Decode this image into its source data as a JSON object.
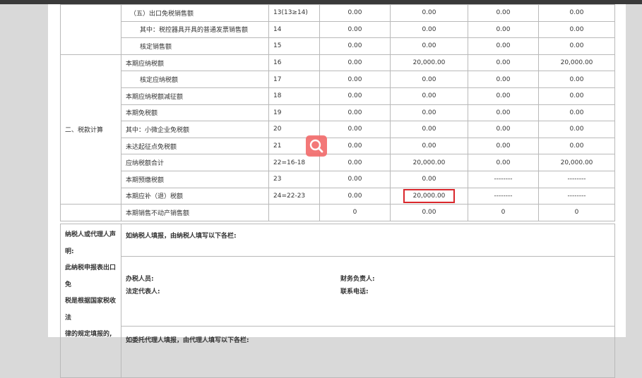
{
  "rows": [
    {
      "label": "（五）出口免税销售额",
      "no": "13(13≥14)",
      "v1": "0.00",
      "v2": "0.00",
      "v3": "0.00",
      "v4": "0.00",
      "indent": 1
    },
    {
      "label": "其中：税控器具开具的普通发票销售额",
      "no": "14",
      "v1": "0.00",
      "v2": "0.00",
      "v3": "0.00",
      "v4": "0.00",
      "indent": 2
    },
    {
      "label": "核定销售额",
      "no": "15",
      "v1": "0.00",
      "v2": "0.00",
      "v3": "0.00",
      "v4": "0.00",
      "indent": 2
    },
    {
      "label": "本期应纳税额",
      "no": "16",
      "v1": "0.00",
      "v2": "20,000.00",
      "v3": "0.00",
      "v4": "20,000.00",
      "indent": 0
    },
    {
      "label": "核定应纳税额",
      "no": "17",
      "v1": "0.00",
      "v2": "0.00",
      "v3": "0.00",
      "v4": "0.00",
      "indent": 2
    },
    {
      "label": "本期应纳税额减征额",
      "no": "18",
      "v1": "0.00",
      "v2": "0.00",
      "v3": "0.00",
      "v4": "0.00",
      "indent": 0
    },
    {
      "label": "本期免税额",
      "no": "19",
      "v1": "0.00",
      "v2": "0.00",
      "v3": "0.00",
      "v4": "0.00",
      "indent": 0
    },
    {
      "label": "其中：小微企业免税额",
      "no": "20",
      "v1": "0.00",
      "v2": "0.00",
      "v3": "0.00",
      "v4": "0.00",
      "indent": 0
    },
    {
      "label": "未达起征点免税额",
      "no": "21",
      "v1": "0.00",
      "v2": "0.00",
      "v3": "0.00",
      "v4": "0.00",
      "indent": 0
    },
    {
      "label": "应纳税额合计",
      "no": "22=16-18",
      "v1": "0.00",
      "v2": "20,000.00",
      "v3": "0.00",
      "v4": "20,000.00",
      "indent": 0
    },
    {
      "label": "本期预缴税额",
      "no": "23",
      "v1": "0.00",
      "v2": "0.00",
      "v3": "--------",
      "v4": "--------",
      "indent": 0
    },
    {
      "label": "本期应补（退）税额",
      "no": "24=22-23",
      "v1": "0.00",
      "v2": "20,000.00",
      "v3": "--------",
      "v4": "--------",
      "indent": 0
    },
    {
      "label": "本期销售不动产销售额",
      "no": "",
      "v1": "0",
      "v2": "0.00",
      "v3": "0",
      "v4": "0",
      "indent": 0
    }
  ],
  "section_tax_calc": "二、税款计算",
  "declaration": {
    "left_lines": [
      "纳税人或代理人声",
      "明:",
      "此纳税申报表出口",
      "免",
      "税是根据国家税收",
      "法",
      "律的规定填报的,"
    ],
    "taxpayer_fill": "如纳税人填报，由纳税人填写以下各栏:",
    "handler": "办税人员:",
    "finance": "财务负责人:",
    "legal": "法定代表人:",
    "phone": "联系电话:",
    "agent_fill": "如委托代理人填报，由代理人填写以下各栏:"
  },
  "icons": {
    "zoom": "search-icon"
  },
  "colors": {
    "highlight": "#d9262b",
    "zoom_button": "#f26d6d"
  }
}
